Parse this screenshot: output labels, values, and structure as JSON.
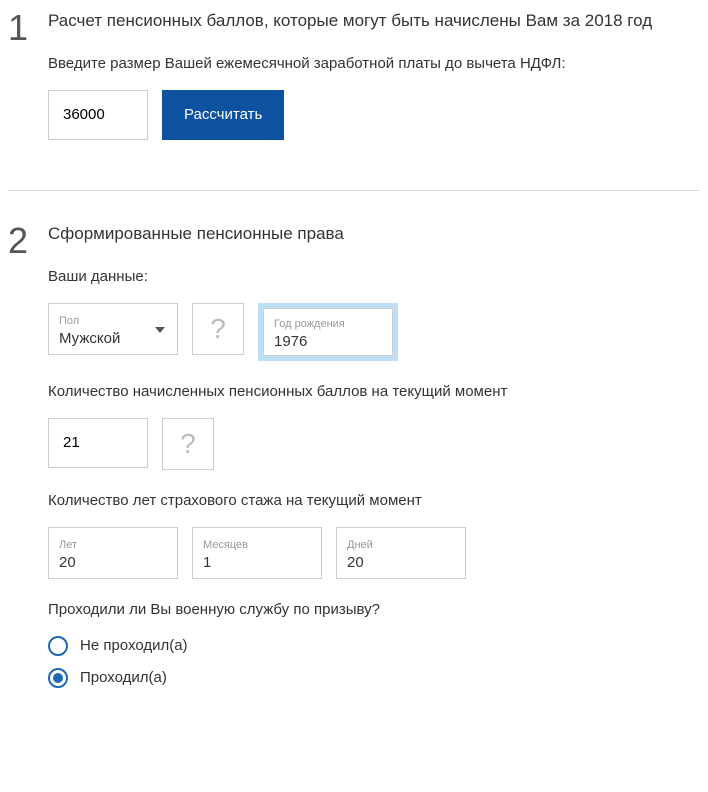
{
  "step1": {
    "number": "1",
    "title": "Расчет пенсионных баллов, которые могут быть начислены Вам за 2018 год",
    "prompt": "Введите размер Вашей ежемесячной заработной платы до вычета НДФЛ:",
    "salary_value": "36000",
    "calc_label": "Рассчитать"
  },
  "step2": {
    "number": "2",
    "title": "Сформированные пенсионные права",
    "your_data_label": "Ваши данные:",
    "gender": {
      "label": "Пол",
      "value": "Мужской"
    },
    "birth_year": {
      "label": "Год рождения",
      "value": "1976"
    },
    "help_glyph": "?",
    "points_label": "Количество начисленных пенсионных баллов на текущий момент",
    "points_value": "21",
    "stazh_label": "Количество лет страхового стажа на текущий момент",
    "years": {
      "label": "Лет",
      "value": "20"
    },
    "months": {
      "label": "Месяцев",
      "value": "1"
    },
    "days": {
      "label": "Дней",
      "value": "20"
    },
    "military_question": "Проходили ли Вы военную службу по призыву?",
    "military_options": {
      "no": "Не проходил(а)",
      "yes": "Проходил(а)"
    },
    "military_selected": "yes"
  }
}
